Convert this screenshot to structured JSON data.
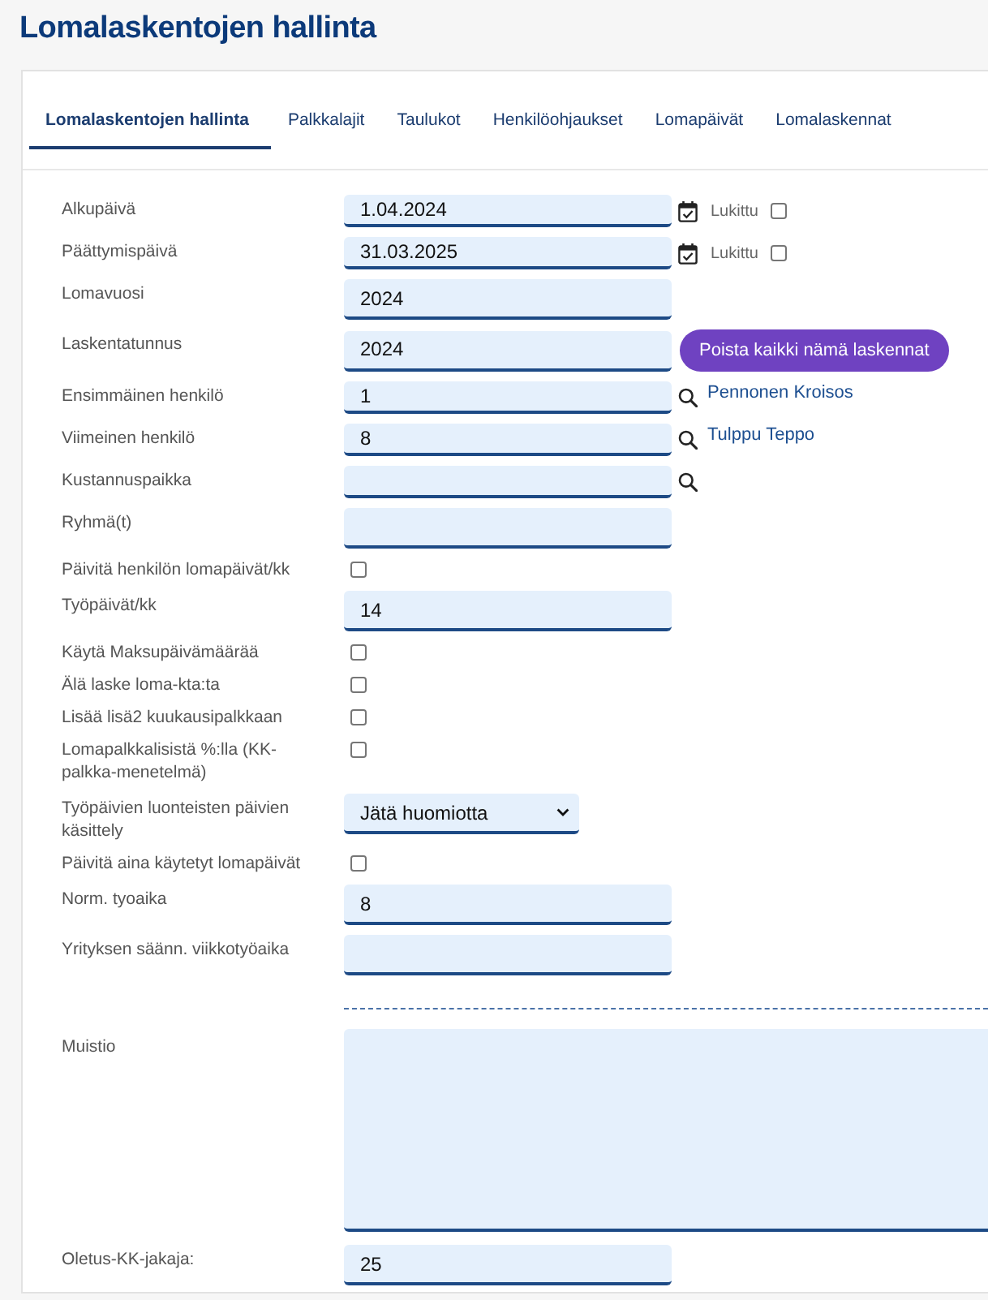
{
  "page": {
    "title": "Lomalaskentojen hallinta"
  },
  "tabs": [
    {
      "label": "Lomalaskentojen hallinta",
      "selected": true
    },
    {
      "label": "Palkkalajit",
      "selected": false
    },
    {
      "label": "Taulukot",
      "selected": false
    },
    {
      "label": "Henkilöohjaukset",
      "selected": false
    },
    {
      "label": "Lomapäivät",
      "selected": false
    },
    {
      "label": "Lomalaskennat",
      "selected": false
    }
  ],
  "form": {
    "rows": [
      {
        "kind": "date",
        "label": "Alkupäivä",
        "value": "1.04.2024",
        "lock_label": "Lukittu",
        "locked": false
      },
      {
        "kind": "date",
        "label": "Päättymispäivä",
        "value": "31.03.2025",
        "lock_label": "Lukittu",
        "locked": false
      },
      {
        "kind": "text",
        "label": "Lomavuosi",
        "value": "2024"
      },
      {
        "kind": "text",
        "label": "Laskentatunnus",
        "value": "2024",
        "button": "Poista kaikki nämä laskennat"
      },
      {
        "kind": "lookup",
        "label": "Ensimmäinen henkilö",
        "value": "1",
        "result": "Pennonen Kroisos"
      },
      {
        "kind": "lookup",
        "label": "Viimeinen henkilö",
        "value": "8",
        "result": "Tulppu Teppo"
      },
      {
        "kind": "lookup",
        "label": "Kustannuspaikka"
      },
      {
        "kind": "text",
        "label": "Ryhmä(t)"
      },
      {
        "kind": "checkbox",
        "label": "Päivitä henkilön lomapäivät/kk",
        "checked": false
      },
      {
        "kind": "text",
        "label": "Työpäivät/kk",
        "value": "14"
      },
      {
        "kind": "checkbox",
        "label": "Käytä Maksupäivämäärää",
        "checked": false
      },
      {
        "kind": "checkbox",
        "label": "Älä laske loma-kta:ta",
        "checked": false
      },
      {
        "kind": "checkbox",
        "label": "Lisää lisä2 kuukausipalkkaan",
        "checked": false
      },
      {
        "kind": "checkbox",
        "label": "Lomapalkkalisistä %:lla (KK-palkka-menetelmä)",
        "checked": false
      },
      {
        "kind": "select",
        "label": "Työpäivien luonteisten päivien käsittely",
        "value": "Jätä huomiotta"
      },
      {
        "kind": "checkbox",
        "label": "Päivitä aina käytetyt lomapäivät",
        "checked": false
      },
      {
        "kind": "text",
        "label": "Norm. tyoaika",
        "value": "8"
      },
      {
        "kind": "text",
        "label": "Yrityksen säänn. viikkotyöaika"
      },
      {
        "kind": "textarea",
        "label": "Muistio"
      },
      {
        "kind": "text",
        "label": "Oletus-KK-jakaja:",
        "value": "25"
      }
    ]
  }
}
